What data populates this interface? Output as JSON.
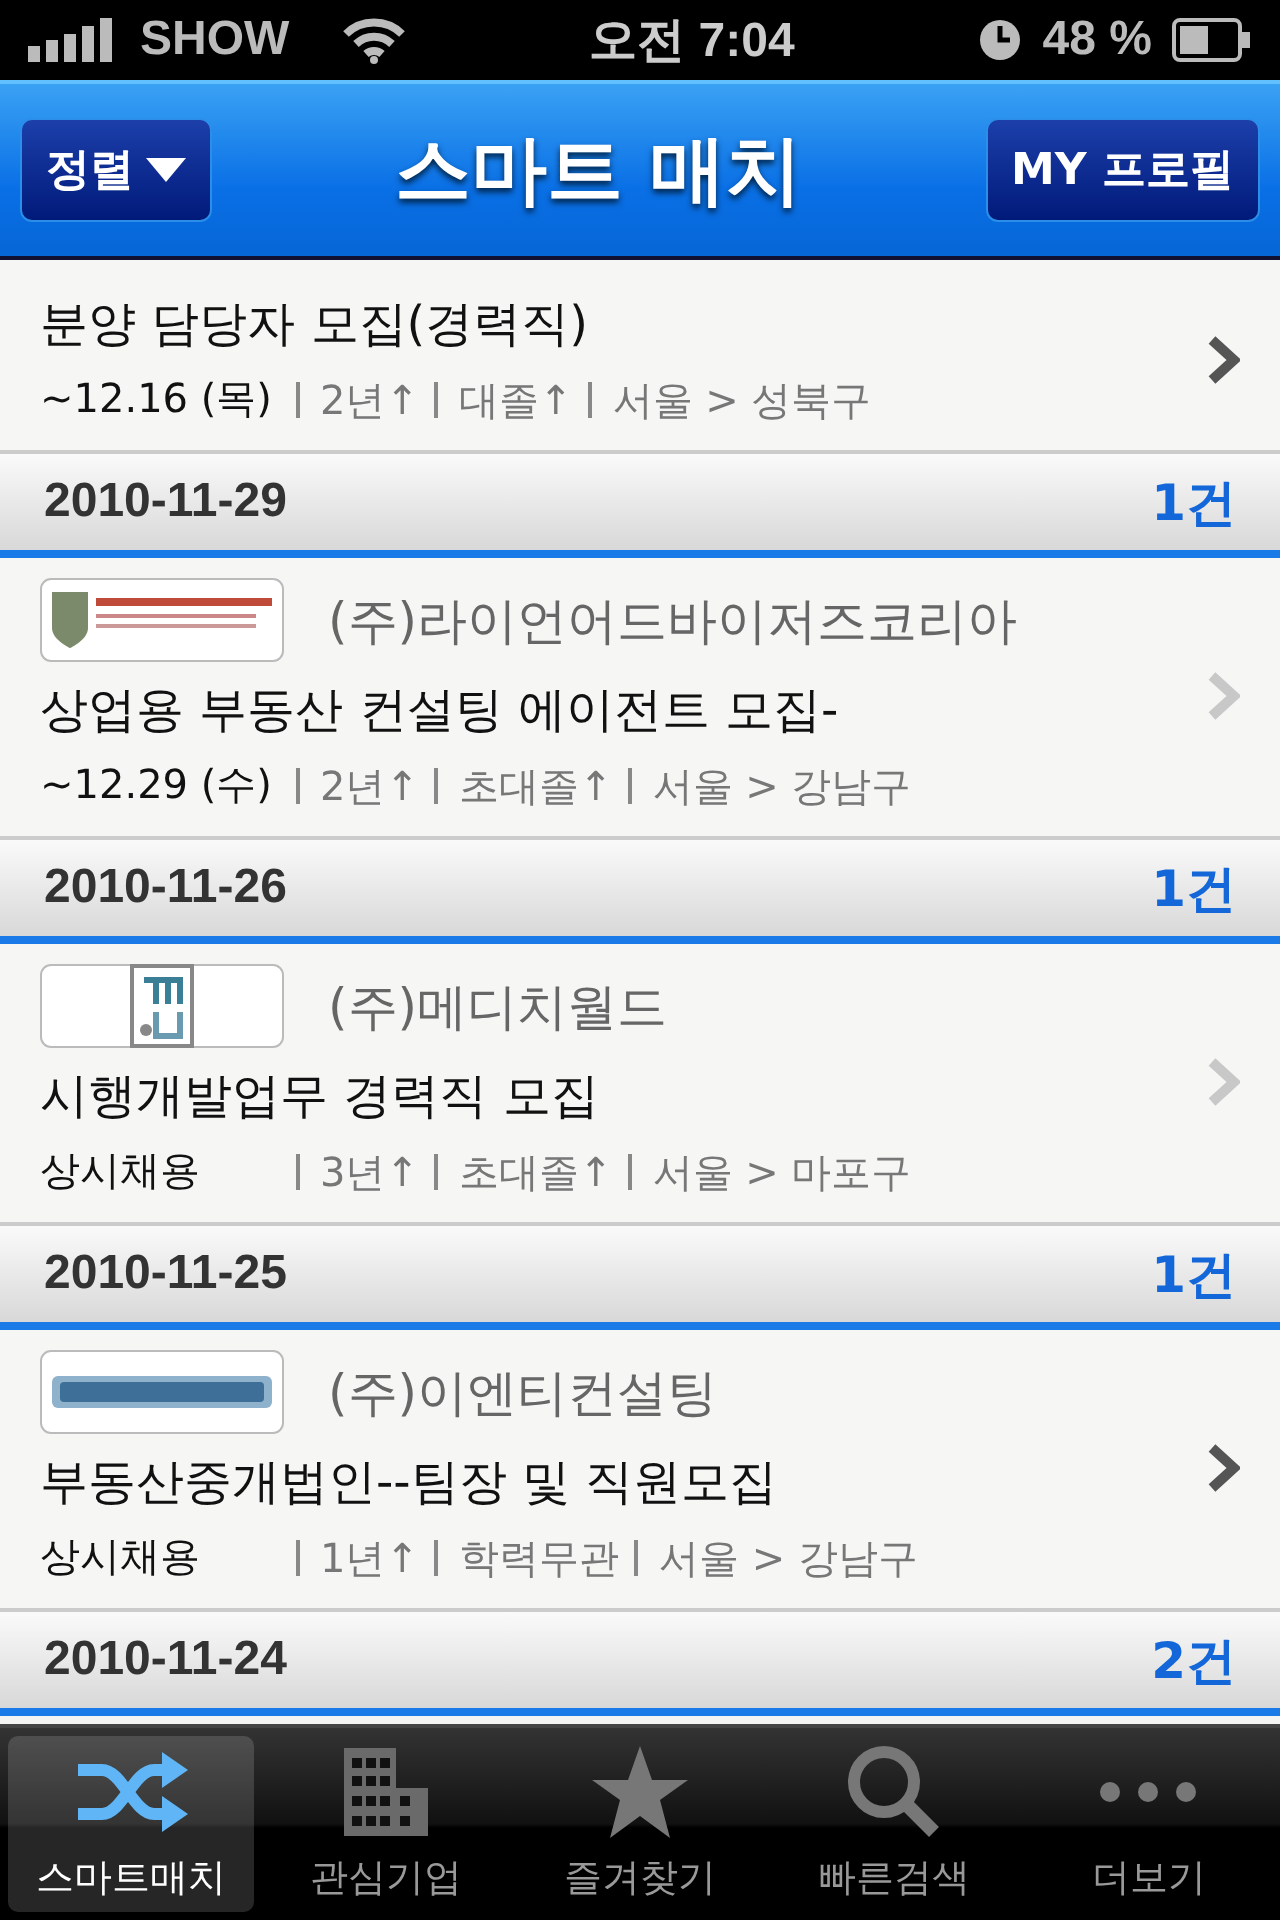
{
  "status_bar": {
    "carrier": "SHOW",
    "time": "오전 7:04",
    "battery": "48 %"
  },
  "nav_bar": {
    "left_button": "정렬",
    "title": "스마트 매치",
    "right_button": "MY 프로필"
  },
  "sections": [
    {
      "items": [
        {
          "title": "분양 담당자 모집(경력직)",
          "deadline": "~12.16 (목)",
          "details": [
            "2년↑",
            "대졸↑",
            "서울 > 성북구"
          ],
          "dimmed": false
        }
      ]
    },
    {
      "date": "2010-11-29",
      "count": "1건",
      "items": [
        {
          "company": "(주)라이언어드바이저즈코리아",
          "title": "상업용 부동산 컨설팅 에이전트 모집-",
          "deadline": "~12.29 (수)",
          "details": [
            "2년↑",
            "초대졸↑",
            "서울 > 강남구"
          ],
          "dimmed": true
        }
      ]
    },
    {
      "date": "2010-11-26",
      "count": "1건",
      "items": [
        {
          "company": "(주)메디치월드",
          "title": "시행개발업무 경력직 모집",
          "deadline": "상시채용",
          "details": [
            "3년↑",
            "초대졸↑",
            "서울 > 마포구"
          ],
          "dimmed": true
        }
      ]
    },
    {
      "date": "2010-11-25",
      "count": "1건",
      "items": [
        {
          "company": "(주)이엔티컨설팅",
          "title": "부동산중개법인--팀장 및 직원모집",
          "deadline": "상시채용",
          "details": [
            "1년↑",
            "학력무관",
            "서울 > 강남구"
          ],
          "dimmed": false
        }
      ]
    },
    {
      "date": "2010-11-24",
      "count": "2건"
    }
  ],
  "tab_bar": [
    {
      "kind": "shuffle",
      "label": "스마트매치",
      "selected": true
    },
    {
      "kind": "building",
      "label": "관심기업",
      "selected": false
    },
    {
      "kind": "star",
      "label": "즐겨찾기",
      "selected": false
    },
    {
      "kind": "search",
      "label": "빠른검색",
      "selected": false
    },
    {
      "kind": "more",
      "label": "더보기",
      "selected": false
    }
  ]
}
